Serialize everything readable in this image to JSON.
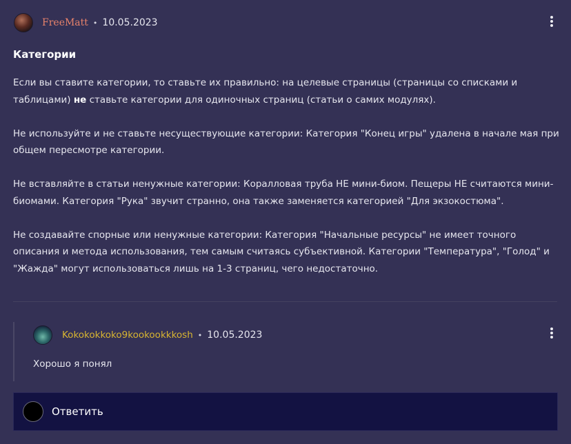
{
  "post": {
    "author": "FreeMatt",
    "separator": "•",
    "date": "10.05.2023",
    "title": "Категории",
    "paragraphs": {
      "p1_line1": "Если вы ставите категории, то ставьте их правильно: на целевые страницы (страницы со списками и таблицами)",
      "p1_bold": "не",
      "p1_rest": " ставьте категории для одиночных страниц (статьи о самих модулях).",
      "p2": "Не используйте и не ставьте несуществующие категории: Категория \"Конец игры\" удалена в начале мая при общем пересмотре категории.",
      "p3": "Не вставляйте в статьи ненужные категории: Коралловая труба НЕ мини-биом. Пещеры НЕ считаются мини-биомами. Категория \"Рука\" звучит странно, она также заменяется категорией \"Для экзокостюма\".",
      "p4": "Не создавайте спорные или ненужные категории: Категория \"Начальные ресурсы\" не имеет точного описания и метода использования, тем самым считаясь субъективной. Категории \"Температура\", \"Голод\" и \"Жажда\" могут использоваться лишь на 1-3 страниц, чего недостаточно."
    }
  },
  "reply": {
    "author": "Kokokokkoko9kookookkkosh",
    "separator": "•",
    "date": "10.05.2023",
    "text": "Хорошо я понял"
  },
  "reply_box": {
    "label": "Ответить"
  },
  "colors": {
    "background": "#343155",
    "author_link": "#e8836b",
    "reply_author_link": "#d8b531",
    "reply_box_bg": "#131242"
  },
  "icons": {
    "post_menu": "more-vertical-icon",
    "reply_menu": "more-vertical-icon"
  }
}
